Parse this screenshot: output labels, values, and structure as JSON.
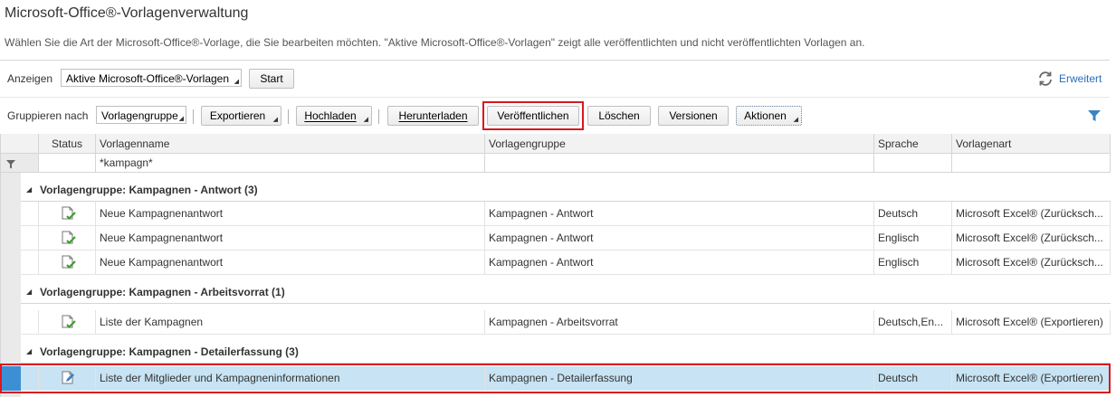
{
  "page": {
    "title": "Microsoft-Office®-Vorlagenverwaltung",
    "description": "Wählen Sie die Art der Microsoft-Office®-Vorlage, die Sie bearbeiten möchten. \"Aktive Microsoft-Office®-Vorlagen\" zeigt alle veröffentlichten und nicht veröffentlichten Vorlagen an."
  },
  "filterbar": {
    "show_label": "Anzeigen",
    "show_value": "Aktive Microsoft-Office®-Vorlagen",
    "start_label": "Start",
    "advanced_label": "Erweitert"
  },
  "toolbar": {
    "group_label": "Gruppieren nach",
    "group_value": "Vorlagengruppe",
    "export_label": "Exportieren",
    "upload_label": "Hochladen",
    "download_label": "Herunterladen",
    "publish_label": "Veröffentlichen",
    "delete_label": "Löschen",
    "versions_label": "Versionen",
    "actions_label": "Aktionen"
  },
  "table": {
    "columns": [
      "Status",
      "Vorlagenname",
      "Vorlagengruppe",
      "Sprache",
      "Vorlagenart"
    ],
    "filter_name": "*kampagn*",
    "groups": [
      {
        "label": "Vorlagengruppe:  Kampagnen - Antwort (3)",
        "rows": [
          {
            "name": "Neue Kampagnenantwort",
            "group": "Kampagnen - Antwort",
            "language": "Deutsch",
            "type": "Microsoft Excel® (Zurücksch..."
          },
          {
            "name": "Neue Kampagnenantwort",
            "group": "Kampagnen - Antwort",
            "language": "Englisch",
            "type": "Microsoft Excel® (Zurücksch..."
          },
          {
            "name": "Neue Kampagnenantwort",
            "group": "Kampagnen - Antwort",
            "language": "Englisch",
            "type": "Microsoft Excel® (Zurücksch..."
          }
        ]
      },
      {
        "label": "Vorlagengruppe:  Kampagnen - Arbeitsvorrat (1)",
        "rows": [
          {
            "name": "Liste der Kampagnen",
            "group": "Kampagnen - Arbeitsvorrat",
            "language": "Deutsch,En...",
            "type": "Microsoft Excel® (Exportieren)"
          }
        ]
      },
      {
        "label": "Vorlagengruppe:  Kampagnen - Detailerfassung (3)",
        "rows": [
          {
            "name": "Liste der Mitglieder und Kampagneninformationen",
            "group": "Kampagnen - Detailerfassung",
            "language": "Deutsch",
            "type": "Microsoft Excel® (Exportieren)"
          }
        ]
      }
    ]
  },
  "colors": {
    "accent": "#2a6ebb",
    "highlight_border": "#d9181e",
    "selected_row": "#c8e3f3"
  }
}
